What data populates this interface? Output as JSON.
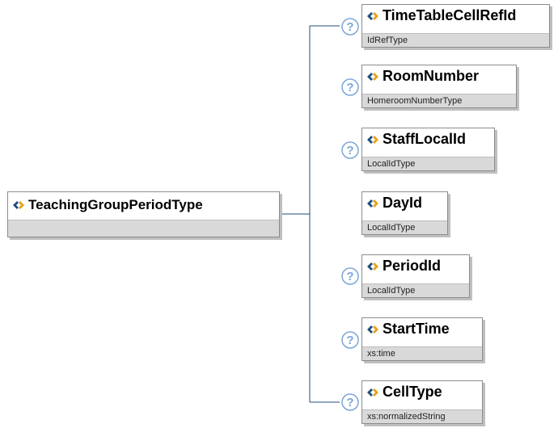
{
  "root": {
    "name": "TeachingGroupPeriodType",
    "type": ""
  },
  "children": [
    {
      "name": "TimeTableCellRefId",
      "type": "IdRefType",
      "optional": true
    },
    {
      "name": "RoomNumber",
      "type": "HomeroomNumberType",
      "optional": true
    },
    {
      "name": "StaffLocalId",
      "type": "LocalIdType",
      "optional": true
    },
    {
      "name": "DayId",
      "type": "LocalIdType",
      "optional": false
    },
    {
      "name": "PeriodId",
      "type": "LocalIdType",
      "optional": true
    },
    {
      "name": "StartTime",
      "type": "xs:time",
      "optional": true
    },
    {
      "name": "CellType",
      "type": "xs:normalizedString",
      "optional": true
    }
  ],
  "colors": {
    "connector": "#1f4e79",
    "optional_marker": "#7aa6d8",
    "element_icon": "#e8a11a"
  },
  "icons": {
    "element": "element-diamond-icon",
    "optional": "question-mark-icon"
  },
  "optional_marker_text": "?"
}
